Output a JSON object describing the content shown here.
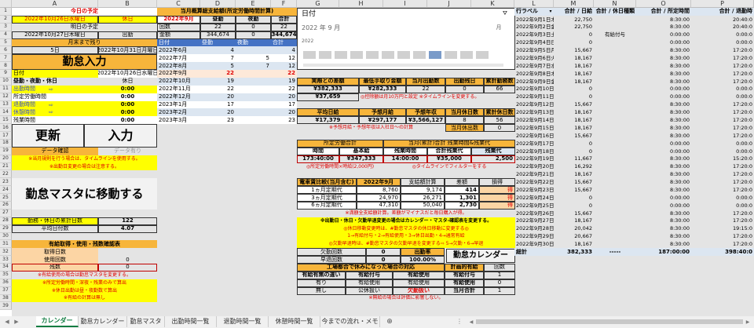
{
  "col_headers": [
    "A",
    "B",
    "C",
    "D",
    "E",
    "F",
    "G",
    "H",
    "I",
    "J",
    "K",
    "L",
    "M",
    "N",
    "O",
    "P"
  ],
  "row_headers": [
    "1",
    "2",
    "3",
    "4",
    "5",
    "6",
    "7",
    "8",
    "9",
    "10",
    "11",
    "12",
    "13",
    "14",
    "15",
    "16",
    "17",
    "18",
    "19",
    "20",
    "21",
    "22",
    "23",
    "24",
    "25",
    "26",
    "27",
    "28",
    "29",
    "30",
    "31",
    "32",
    "33",
    "34",
    "35",
    "36",
    "37",
    "38",
    "39"
  ],
  "left": {
    "today_label": "今日の予定",
    "today_date": "2022年10月26日水曜日",
    "today_status": "休日",
    "tomorrow_label": "明日の予定",
    "tomorrow_date": "2022年10月27日木曜日",
    "tomorrow_status": "出勤",
    "month_end_label": "月末まで残り",
    "days_left": "5日",
    "month_end_date": "2022年10月31日月曜日",
    "kintai_title": "勤怠入力",
    "date_label": "日付",
    "date_value": "2022年10月26日水曜日",
    "type_label": "昼勤・夜勤・休日",
    "type_value": "休日",
    "rows": [
      {
        "label": "出勤時間",
        "value": "0:00"
      },
      {
        "label": "所定労働時間",
        "value": ""
      },
      {
        "label": "退勤時間",
        "value": "0:00"
      },
      {
        "label": "休憩時間",
        "value": "0:00"
      },
      {
        "label": "残業時間",
        "value": "0:00"
      }
    ],
    "shotei_value": "0:00",
    "update_btn": "更新",
    "input_btn": "入力",
    "data_check": "データ確認",
    "data_present": "データ有り",
    "note1": "※当月規則を行う場合は、タイムラインを使用する。",
    "note2": "※出勤日変更の場合は注意する。",
    "move_btn": "勤怠マスタに移動する",
    "cum_label": "勤務・休日の累計日数",
    "cum_value": "122",
    "avg_label": "平均日付数",
    "avg_value": "4.07",
    "paid_title": "有給取得・使用・残数確認表",
    "paid_rows": [
      {
        "label": "取得日数",
        "value": ""
      },
      {
        "label": "使用回数",
        "value": "0"
      },
      {
        "label": "残数",
        "value": "0"
      }
    ],
    "paid_note": "※有給使用の場合は勤怠マスタを変更する。",
    "foot1": "※所定労働時間・深夜・残業のみで算出",
    "foot2": "※休日出勤は昼・夜勤数で算出",
    "foot3": "※有給の計算は無し"
  },
  "wage": {
    "title": "当月概算総支給額(所定労働時間計算)",
    "month": "2022年9月",
    "h_day": "昼勤",
    "h_night": "夜勤",
    "h_total": "合計",
    "cnt_label": "回数",
    "cnt_day": "22",
    "cnt_night": "0",
    "cnt_total": "22",
    "amt_label": "金額",
    "amt_day": "344,674",
    "amt_night": "0",
    "amt_total": "344,674",
    "tbl_h": [
      "日付",
      "昼勤",
      "夜勤",
      "合計"
    ],
    "tbl": [
      [
        "2022年6月",
        "4",
        "",
        "4"
      ],
      [
        "2022年7月",
        "7",
        "5",
        "12"
      ],
      [
        "2022年8月",
        "5",
        "7",
        "12"
      ],
      [
        "2022年9月",
        "22",
        "",
        "22"
      ],
      [
        "2022年10月",
        "19",
        "",
        "19"
      ],
      [
        "2022年11月",
        "22",
        "",
        "22"
      ],
      [
        "2022年12月",
        "20",
        "",
        "20"
      ],
      [
        "2023年1月",
        "17",
        "",
        "17"
      ],
      [
        "2023年2月",
        "20",
        "",
        "20"
      ],
      [
        "2023年3月",
        "23",
        "",
        "23"
      ]
    ]
  },
  "slicer": {
    "title": "日付",
    "period": "2022 年 9 月",
    "level": "月",
    "year": "2022"
  },
  "diff": {
    "h": [
      "実際との差額",
      "最低手取り金額",
      "当月出勤数",
      "出勤残日",
      "累計勤務数"
    ],
    "v": [
      "¥382,333",
      "¥282,333",
      "22",
      "0",
      "66"
    ],
    "v2": "¥37,659",
    "note": "◎控除額は月10万円と設定 ※タイムラインを変更する。"
  },
  "avg": {
    "h": [
      "平均日給",
      "予想月給",
      "予想年収",
      "当月休日数",
      "累計休日数"
    ],
    "v": [
      "¥17,379",
      "¥297,177",
      "¥3,566,127",
      "8",
      "56"
    ],
    "note": "※予想月給・予想年収は入社日〜の計算",
    "cur_label": "当月休出数",
    "cur_value": "0"
  },
  "ot": {
    "t1": "所定労働合計",
    "t2": "当月(累計)合計 残業時間&残業代",
    "h": [
      "時間",
      "基本給",
      "残業時間",
      "合計残業代",
      "残業代"
    ],
    "v": [
      "173:40:00",
      "¥347,333",
      "14:00:00",
      "¥35,000",
      "2,500"
    ],
    "n1": "◎所定労働時間×時給(2,000円)",
    "n2": "◎タイムラインでフィルターをする"
  },
  "elec": {
    "title": "電車賃比較(当月含む)",
    "month": "2022年9月",
    "h3": "支給額計算",
    "h4": "差額",
    "h5": "損得",
    "rows": [
      [
        "1ヵ月定期代",
        "8,760",
        "9,174",
        "414",
        "得"
      ],
      [
        "3ヵ月定期代",
        "24,970",
        "26,271",
        "1,301",
        "得"
      ],
      [
        "6ヵ月定期代",
        "47,310",
        "50,040",
        "2,730",
        "得"
      ]
    ],
    "note": "※満額全支給額計算。差額がマイナスだと毎日購入が得。"
  },
  "warn": {
    "l1": "※出勤日・休日・欠勤早退変更の場合はカレンダー・マスタ-確認表を変更する。",
    "l2": "◎休日移動変更時は、#勤怠マスタの休日移動に変更する◎",
    "l3": "1→有給付与・2→有給使用・3→休日出勤・4→通常有給",
    "l4": "◎欠勤早退時は、#勤怠マスタの欠勤早退を変更する⇨ 5→欠勤・6→早退"
  },
  "absent": {
    "l1": "欠勤回数",
    "v1": "0",
    "h": "出勤率",
    "l2": "早退回数",
    "v2": "0",
    "rate": "100.00%",
    "cal_btn": "勤怠カレンダー",
    "factory_title": "工場都合で休みになった場合の対応",
    "plan_label": "計画的有給",
    "plan_h": "回数",
    "rows": [
      [
        "有給有無の違い",
        "有給付与",
        "有給使用"
      ],
      [
        "有り",
        "有給使用",
        "有給使用"
      ],
      [
        "無し",
        "公休扱い",
        "欠勤扱い"
      ]
    ],
    "plan_rows": [
      [
        "有給付与",
        "1"
      ],
      [
        "有給使用",
        "0"
      ],
      [
        "当月合計",
        "1"
      ]
    ],
    "note": "※無給の場合は評価に影響しない。"
  },
  "pivot": {
    "h": [
      "行ラベル",
      "合計 / 日給",
      "合計 / 休日種類",
      "合計 / 所定時間",
      "合計 / 退勤時"
    ],
    "rows": [
      [
        "2022年9月1日木曜日",
        "22,750",
        "",
        "8:30:00",
        "20:40:0"
      ],
      [
        "2022年9月2日金曜日",
        "22,750",
        "",
        "8:30:00",
        "20:40:0"
      ],
      [
        "2022年9月3日土曜日",
        "0",
        "有給付与",
        "0:00:00",
        "0:00:0"
      ],
      [
        "2022年9月4日日曜日",
        "0",
        "",
        "0:00:00",
        "0:00:0"
      ],
      [
        "2022年9月5日月曜日",
        "15,667",
        "",
        "8:30:00",
        "17:20:0"
      ],
      [
        "2022年9月6日火曜日",
        "18,167",
        "",
        "8:30:00",
        "17:20:0"
      ],
      [
        "2022年9月7日水曜日",
        "18,167",
        "",
        "8:30:00",
        "17:20:0"
      ],
      [
        "2022年9月8日木曜日",
        "18,167",
        "",
        "8:30:00",
        "17:20:0"
      ],
      [
        "2022年9月9日金曜日",
        "18,167",
        "",
        "8:30:00",
        "17:20:0"
      ],
      [
        "2022年9月10日土曜日",
        "0",
        "",
        "0:00:00",
        "0:00:0"
      ],
      [
        "2022年9月11日日曜日",
        "0",
        "",
        "0:00:00",
        "0:00:0"
      ],
      [
        "2022年9月12日月曜日",
        "15,667",
        "",
        "8:30:00",
        "17:20:0"
      ],
      [
        "2022年9月13日火曜日",
        "18,167",
        "",
        "8:30:00",
        "17:20:0"
      ],
      [
        "2022年9月14日水曜日",
        "18,167",
        "",
        "8:30:00",
        "17:20:0"
      ],
      [
        "2022年9月15日木曜日",
        "18,167",
        "",
        "8:30:00",
        "17:20:0"
      ],
      [
        "2022年9月16日金曜日",
        "15,667",
        "",
        "8:30:00",
        "17:20:0"
      ],
      [
        "2022年9月17日土曜日",
        "0",
        "",
        "0:00:00",
        "0:00:0"
      ],
      [
        "2022年9月18日日曜日",
        "0",
        "",
        "0:00:00",
        "0:00:0"
      ],
      [
        "2022年9月19日月曜日",
        "11,667",
        "",
        "8:30:00",
        "15:20:0"
      ],
      [
        "2022年9月20日火曜日",
        "16,292",
        "",
        "8:30:00",
        "17:20:0"
      ],
      [
        "2022年9月21日水曜日",
        "18,167",
        "",
        "8:30:00",
        "17:20:0"
      ],
      [
        "2022年9月22日木曜日",
        "15,667",
        "",
        "8:30:00",
        "17:20:0"
      ],
      [
        "2022年9月23日金曜日",
        "15,667",
        "",
        "8:30:00",
        "17:20:0"
      ],
      [
        "2022年9月24日土曜日",
        "0",
        "",
        "0:00:00",
        "0:00:0"
      ],
      [
        "2022年9月25日日曜日",
        "0",
        "",
        "0:00:00",
        "0:00:0"
      ],
      [
        "2022年9月26日月曜日",
        "15,667",
        "",
        "8:30:00",
        "17:20:0"
      ],
      [
        "2022年9月27日火曜日",
        "18,167",
        "",
        "8:30:00",
        "17:20:0"
      ],
      [
        "2022年9月28日水曜日",
        "20,042",
        "",
        "8:30:00",
        "19:15:0"
      ],
      [
        "2022年9月29日木曜日",
        "20,667",
        "",
        "8:30:00",
        "17:20:0"
      ],
      [
        "2022年9月30日金曜日",
        "18,167",
        "",
        "8:30:00",
        "17:20:0"
      ]
    ],
    "total": [
      "総計",
      "382,333",
      "-----",
      "187:00:00",
      "398:40:0"
    ]
  },
  "tabs": [
    "カレンダー",
    "勤怠カレンダー",
    "勤怠マスタ",
    "出勤時間一覧",
    "退勤時間一覧",
    "休憩時間一覧",
    "今までの流れ・メモ"
  ],
  "colors": {
    "yellow": "#ffff00",
    "orange": "#f7b53b",
    "light_orange": "#fcd5a4",
    "blue_hdr": "#4472c4",
    "red": "#c00000",
    "pink": "#ffd0e0"
  }
}
